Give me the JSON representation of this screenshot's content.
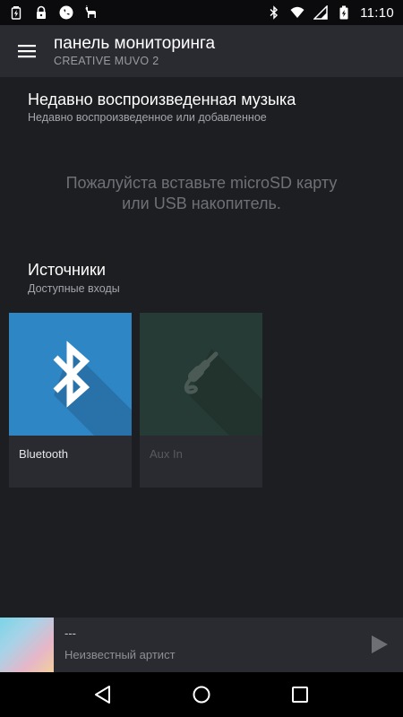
{
  "status_bar": {
    "left_icons": [
      "battery-charging-icon",
      "lock-icon",
      "phone-icon",
      "llama-icon"
    ],
    "right_icons": [
      "bluetooth-icon",
      "wifi-icon",
      "cell-signal-icon",
      "battery-icon"
    ],
    "time": "11:10"
  },
  "app_bar": {
    "title": "панель мониторинга",
    "subtitle": "CREATIVE MUVO 2"
  },
  "recent": {
    "title": "Недавно воспроизведенная музыка",
    "subtitle": "Недавно воспроизведенное или добавленное",
    "empty_line1": "Пожалуйста вставьте microSD карту",
    "empty_line2": "или USB накопитель."
  },
  "sources": {
    "title": "Источники",
    "subtitle": "Доступные входы",
    "tiles": [
      {
        "label": "Bluetooth",
        "icon": "bluetooth-icon",
        "color": "#2f86c5",
        "enabled": true
      },
      {
        "label": "Aux In",
        "icon": "aux-jack-icon",
        "color": "#263b35",
        "enabled": false
      }
    ]
  },
  "now_playing": {
    "title": "---",
    "artist": "Неизвестный артист"
  },
  "nav_bar": {
    "buttons": [
      "back-icon",
      "home-icon",
      "recents-icon"
    ]
  }
}
